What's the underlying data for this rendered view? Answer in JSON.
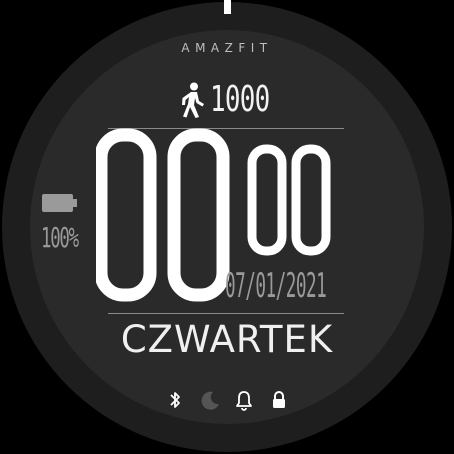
{
  "brand": "AMAZFIT",
  "steps": {
    "icon": "walking-person-icon",
    "value": "1000"
  },
  "time": {
    "hours": "00",
    "minutes": "00"
  },
  "battery": {
    "icon": "battery-icon",
    "value": "100%",
    "level": 1.0
  },
  "date": "07/01/2021",
  "weekday": "CZWARTEK",
  "status_icons": [
    "bluetooth-icon",
    "moon-icon",
    "bell-icon",
    "lock-icon"
  ],
  "colors": {
    "background": "#2a2a2a",
    "bezel": "#1e1e1e",
    "primary": "#ffffff",
    "secondary": "#9a9a9a"
  }
}
